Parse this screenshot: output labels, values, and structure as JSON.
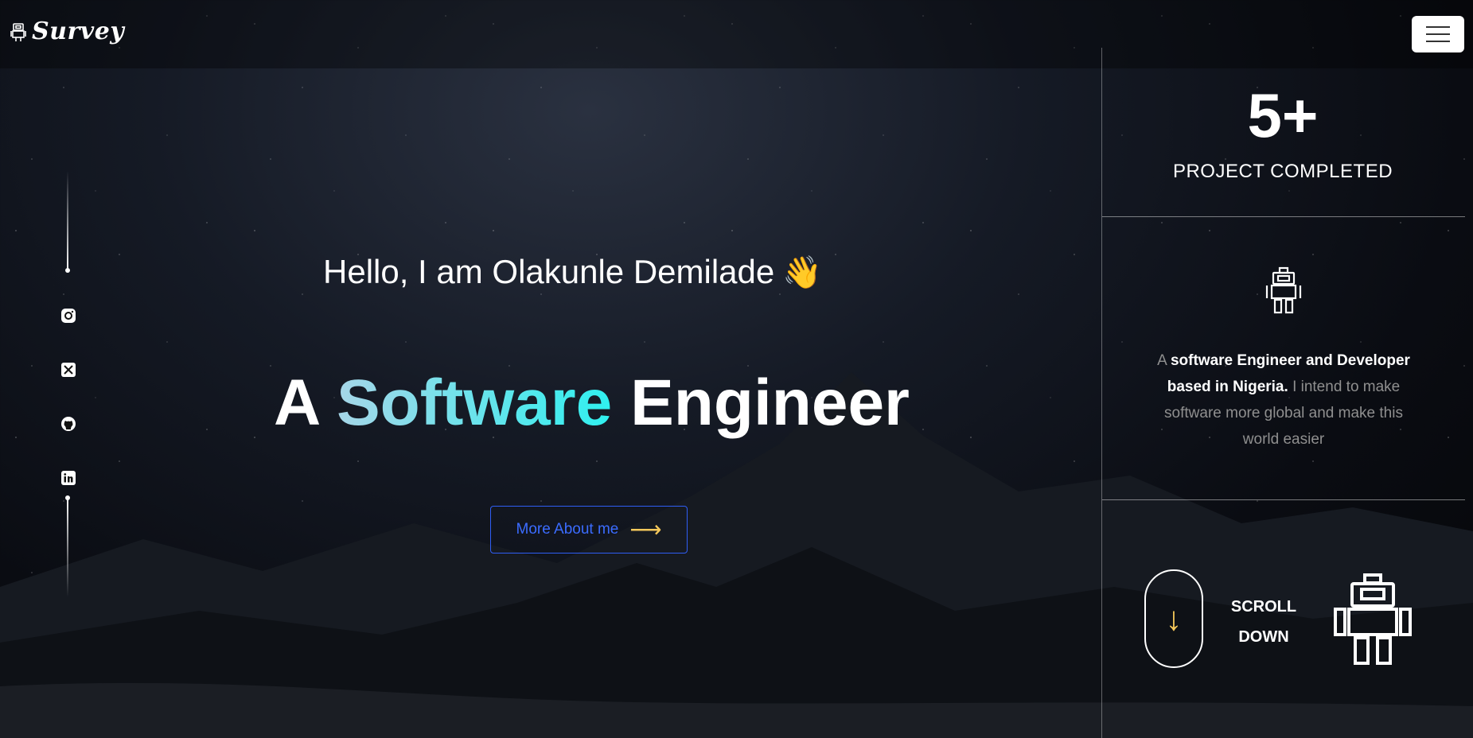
{
  "header": {
    "brand": "Survey",
    "icons": {
      "logo": "robot-icon",
      "menu": "hamburger-menu-icon"
    }
  },
  "social": {
    "items": [
      {
        "name": "instagram",
        "icon": "instagram-icon"
      },
      {
        "name": "x",
        "icon": "x-twitter-icon"
      },
      {
        "name": "github",
        "icon": "github-icon"
      },
      {
        "name": "linkedin",
        "icon": "linkedin-icon"
      }
    ]
  },
  "hero": {
    "greeting": "Hello, I am Olakunle Demilade",
    "greeting_emoji": "👋",
    "headline_prefix": "A",
    "headline_accent": "Software",
    "headline_suffix": "Engineer",
    "cta_label": "More About me",
    "cta_arrow": "⟶"
  },
  "sidebar": {
    "stat_value": "5+",
    "stat_label": "PROJECT COMPLETED",
    "bio": {
      "part1": "A",
      "part2": "software Engineer and Developer based in Nigeria.",
      "part3": "I intend to make software more global and make this world easier"
    },
    "scroll_line1": "SCROLL",
    "scroll_line2": "DOWN",
    "scroll_arrow": "↓"
  },
  "colors": {
    "accent_start": "#a6d6e8",
    "accent_end": "#2ff0ef",
    "cta_blue": "#3b6cff",
    "arrow_yellow": "#f5c85b"
  }
}
